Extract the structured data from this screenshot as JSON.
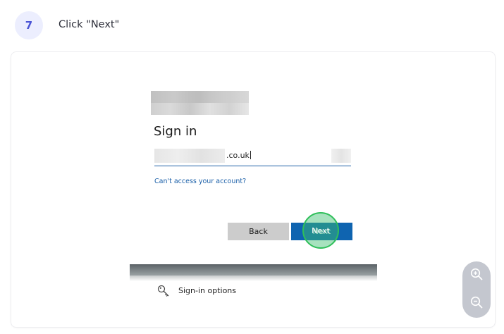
{
  "step": {
    "number": "7",
    "instruction": "Click \"Next\""
  },
  "screenshot": {
    "title": "Sign in",
    "email": {
      "value_suffix": ".co.uk"
    },
    "cant_access_link": "Can't access your account?",
    "back_label": "Back",
    "next_label": "Next",
    "signin_options_label": "Sign-in options"
  },
  "icons": {
    "key": "key-icon",
    "zoom_in": "zoom-in-icon",
    "zoom_out": "zoom-out-icon"
  },
  "colors": {
    "accent": "#4b55d6",
    "badge_bg": "#eceefe",
    "next_button": "#0f64b0",
    "back_button": "#cccccc",
    "highlight": "#2fbf5a",
    "link": "#1a5fa8"
  }
}
